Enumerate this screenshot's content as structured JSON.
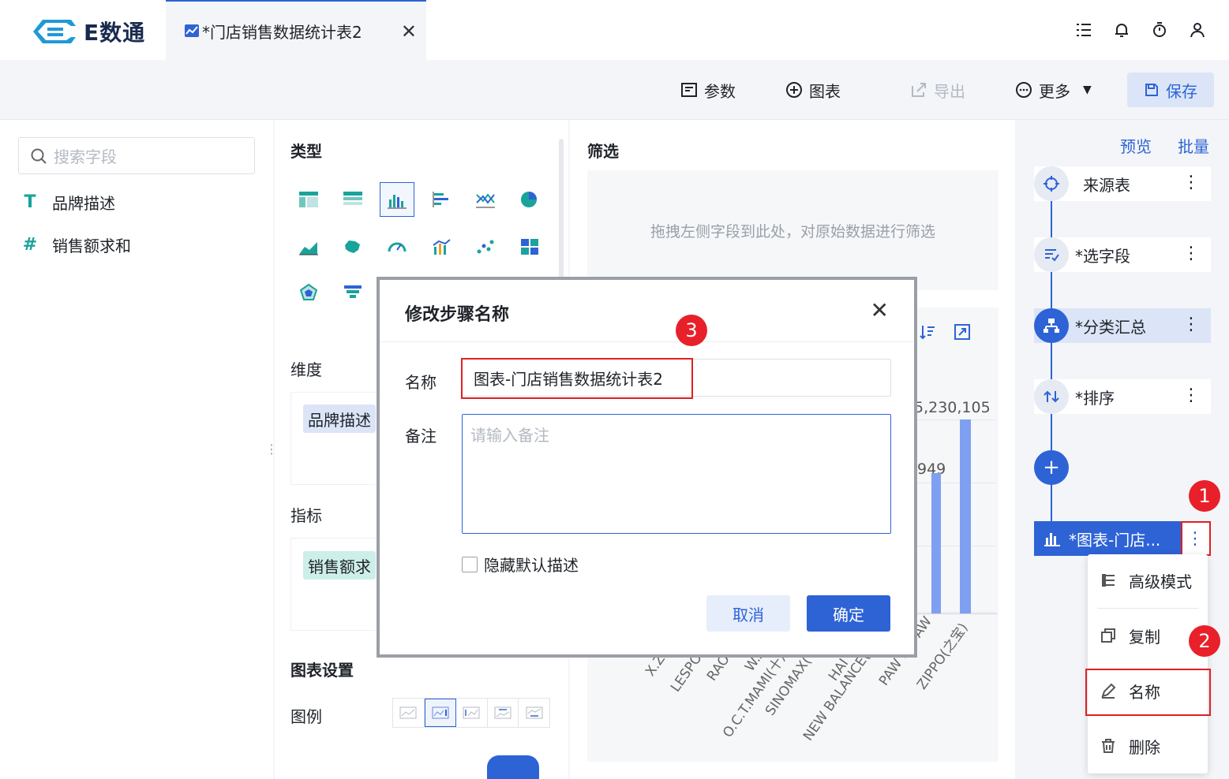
{
  "app": {
    "logo_text": "E数通"
  },
  "tab": {
    "title": "*门店销售数据统计表2"
  },
  "toolbar": {
    "params": "参数",
    "chart": "图表",
    "export": "导出",
    "more": "更多",
    "save": "保存"
  },
  "fields": {
    "search_placeholder": "搜索字段",
    "items": [
      {
        "label": "品牌描述",
        "type": "T"
      },
      {
        "label": "销售额求和",
        "type": "#"
      }
    ]
  },
  "config": {
    "type_title": "类型",
    "dimension_label": "维度",
    "dimension_chip": "品牌描述",
    "metric_label": "指标",
    "metric_chip": "销售额求",
    "chart_settings_title": "图表设置",
    "legend_label": "图例"
  },
  "filter": {
    "title": "筛选",
    "hint": "拖拽左侧字段到此处，对原始数据进行筛选"
  },
  "chart_preview": {
    "value_labels": [
      "5,230,105",
      "949"
    ],
    "x_labels": [
      "X.ZI",
      "LESPO",
      "RAO",
      "W.A",
      "O.C.T.MAMI(十月",
      "SINOMAX(",
      "HAI",
      "NEW BALANCE(",
      "PAW IN PAW",
      "ZIPPO(之宝)"
    ]
  },
  "flow": {
    "preview": "预览",
    "batch": "批量",
    "steps": [
      {
        "label": "来源表",
        "icon": "target-icon"
      },
      {
        "label": "*选字段",
        "icon": "field-select-icon"
      },
      {
        "label": "*分类汇总",
        "icon": "group-icon"
      },
      {
        "label": "*排序",
        "icon": "sort-icon"
      }
    ],
    "active_step": "*图表-门店..."
  },
  "context_menu": {
    "items": [
      "高级模式",
      "复制",
      "名称",
      "删除"
    ]
  },
  "dialog": {
    "title": "修改步骤名称",
    "name_label": "名称",
    "name_value": "图表-门店销售数据统计表2",
    "note_label": "备注",
    "note_placeholder": "请输入备注",
    "hide_default": "隐藏默认描述",
    "cancel": "取消",
    "ok": "确定"
  },
  "badges": [
    "1",
    "2",
    "3"
  ],
  "colors": {
    "accent": "#2e63d6",
    "badge": "#e8202a",
    "teal": "#1aa39a"
  }
}
